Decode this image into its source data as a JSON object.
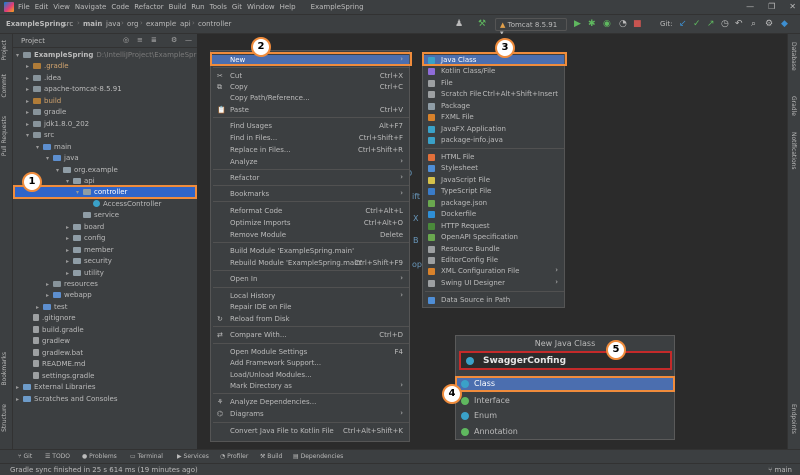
{
  "menubar": {
    "items": [
      "File",
      "Edit",
      "View",
      "Navigate",
      "Code",
      "Refactor",
      "Build",
      "Run",
      "Tools",
      "Git",
      "Window",
      "Help"
    ],
    "window_title": "ExampleSpring",
    "controls": [
      "—",
      "❐",
      "✕"
    ]
  },
  "navbar": {
    "breadcrumbs": [
      "ExampleSpring",
      "src",
      "main",
      "java",
      "org",
      "example",
      "api",
      "controller"
    ],
    "run_config": "Tomcat 8.5.91",
    "git_label": "Git:"
  },
  "project_panel": {
    "title": "Project"
  },
  "tree": [
    {
      "label": "ExampleSpring",
      "suffix": "D:\\IntelliJProject\\ExampleSpring"
    },
    {
      "label": ".gradle"
    },
    {
      "label": ".idea"
    },
    {
      "label": "apache-tomcat-8.5.91"
    },
    {
      "label": "build"
    },
    {
      "label": "gradle"
    },
    {
      "label": "jdk1.8.0_202"
    },
    {
      "label": "src"
    },
    {
      "label": "main"
    },
    {
      "label": "java"
    },
    {
      "label": "org.example"
    },
    {
      "label": "api"
    },
    {
      "label": "controller"
    },
    {
      "label": "AccessController"
    },
    {
      "label": "service"
    },
    {
      "label": "board"
    },
    {
      "label": "config"
    },
    {
      "label": "member"
    },
    {
      "label": "security"
    },
    {
      "label": "utility"
    },
    {
      "label": "resources"
    },
    {
      "label": "webapp"
    },
    {
      "label": "test"
    },
    {
      "label": ".gitignore"
    },
    {
      "label": "build.gradle"
    },
    {
      "label": "gradlew"
    },
    {
      "label": "gradlew.bat"
    },
    {
      "label": "README.md"
    },
    {
      "label": "settings.gradle"
    },
    {
      "label": "External Libraries"
    },
    {
      "label": "Scratches and Consoles"
    }
  ],
  "context_menu": [
    {
      "label": "New",
      "shortcut": ""
    },
    {
      "label": "Cut",
      "shortcut": "Ctrl+X"
    },
    {
      "label": "Copy",
      "shortcut": "Ctrl+C"
    },
    {
      "label": "Copy Path/Reference...",
      "shortcut": ""
    },
    {
      "label": "Paste",
      "shortcut": "Ctrl+V"
    },
    {
      "label": "Find Usages",
      "shortcut": "Alt+F7"
    },
    {
      "label": "Find in Files...",
      "shortcut": "Ctrl+Shift+F"
    },
    {
      "label": "Replace in Files...",
      "shortcut": "Ctrl+Shift+R"
    },
    {
      "label": "Analyze",
      "shortcut": ""
    },
    {
      "label": "Refactor",
      "shortcut": ""
    },
    {
      "label": "Bookmarks",
      "shortcut": ""
    },
    {
      "label": "Reformat Code",
      "shortcut": "Ctrl+Alt+L"
    },
    {
      "label": "Optimize Imports",
      "shortcut": "Ctrl+Alt+O"
    },
    {
      "label": "Remove Module",
      "shortcut": "Delete"
    },
    {
      "label": "Build Module 'ExampleSpring.main'",
      "shortcut": ""
    },
    {
      "label": "Rebuild Module 'ExampleSpring.main'",
      "shortcut": "Ctrl+Shift+F9"
    },
    {
      "label": "Open In",
      "shortcut": ""
    },
    {
      "label": "Local History",
      "shortcut": ""
    },
    {
      "label": "Repair IDE on File",
      "shortcut": ""
    },
    {
      "label": "Reload from Disk",
      "shortcut": ""
    },
    {
      "label": "Compare With...",
      "shortcut": "Ctrl+D"
    },
    {
      "label": "Open Module Settings",
      "shortcut": "F4"
    },
    {
      "label": "Add Framework Support...",
      "shortcut": ""
    },
    {
      "label": "Load/Unload Modules...",
      "shortcut": ""
    },
    {
      "label": "Mark Directory as",
      "shortcut": ""
    },
    {
      "label": "Analyze Dependencies...",
      "shortcut": ""
    },
    {
      "label": "Diagrams",
      "shortcut": ""
    },
    {
      "label": "Convert Java File to Kotlin File",
      "shortcut": "Ctrl+Alt+Shift+K"
    }
  ],
  "submenu": [
    {
      "label": "Java Class",
      "shortcut": "",
      "color": "#3aa1c8"
    },
    {
      "label": "Kotlin Class/File",
      "shortcut": "",
      "color": "#8f6cd8"
    },
    {
      "label": "File",
      "shortcut": "",
      "color": "#9da0a2"
    },
    {
      "label": "Scratch File",
      "shortcut": "Ctrl+Alt+Shift+Insert",
      "color": "#9da0a2"
    },
    {
      "label": "Package",
      "shortcut": "",
      "color": "#8f9da6"
    },
    {
      "label": "FXML File",
      "shortcut": "",
      "color": "#d9822b"
    },
    {
      "label": "JavaFX Application",
      "shortcut": "",
      "color": "#3aa1c8"
    },
    {
      "label": "package-info.java",
      "shortcut": "",
      "color": "#3aa1c8"
    },
    {
      "label": "HTML File",
      "shortcut": "",
      "color": "#e2703a"
    },
    {
      "label": "Stylesheet",
      "shortcut": "",
      "color": "#4f8ed6"
    },
    {
      "label": "JavaScript File",
      "shortcut": "",
      "color": "#d6c24a"
    },
    {
      "label": "TypeScript File",
      "shortcut": "",
      "color": "#3a7cc9"
    },
    {
      "label": "package.json",
      "shortcut": "",
      "color": "#6aa84f"
    },
    {
      "label": "Dockerfile",
      "shortcut": "",
      "color": "#2f8fd6"
    },
    {
      "label": "HTTP Request",
      "shortcut": "",
      "color": "#4a8a3a"
    },
    {
      "label": "OpenAPI Specification",
      "shortcut": "",
      "color": "#6aa84f"
    },
    {
      "label": "Resource Bundle",
      "shortcut": "",
      "color": "#9da0a2"
    },
    {
      "label": "EditorConfig File",
      "shortcut": "",
      "color": "#9da0a2"
    },
    {
      "label": "XML Configuration File",
      "shortcut": "",
      "color": "#d9822b"
    },
    {
      "label": "Swing UI Designer",
      "shortcut": "",
      "color": "#9da0a2"
    },
    {
      "label": "Data Source in Path",
      "shortcut": "",
      "color": "#4f8ed6"
    }
  ],
  "editor_fragments": [
    "ift",
    "X",
    "B",
    "op",
    "D"
  ],
  "dialog": {
    "title": "New Java Class",
    "input_value": "SwaggerConfing",
    "kinds": [
      "Class",
      "Interface",
      "Enum",
      "Annotation"
    ]
  },
  "badges": [
    "1",
    "2",
    "3",
    "4",
    "5"
  ],
  "bottom_tabs": [
    "Git",
    "TODO",
    "Problems",
    "Terminal",
    "Services",
    "Profiler",
    "Build",
    "Dependencies"
  ],
  "side_tabs_left": [
    "Project",
    "Commit",
    "Pull Requests",
    "Bookmarks",
    "Structure"
  ],
  "side_tabs_right": [
    "Database",
    "Gradle",
    "Notifications",
    "Endpoints"
  ],
  "status": {
    "message": "Gradle sync finished in 25 s 614 ms (19 minutes ago)",
    "branch": "main"
  }
}
